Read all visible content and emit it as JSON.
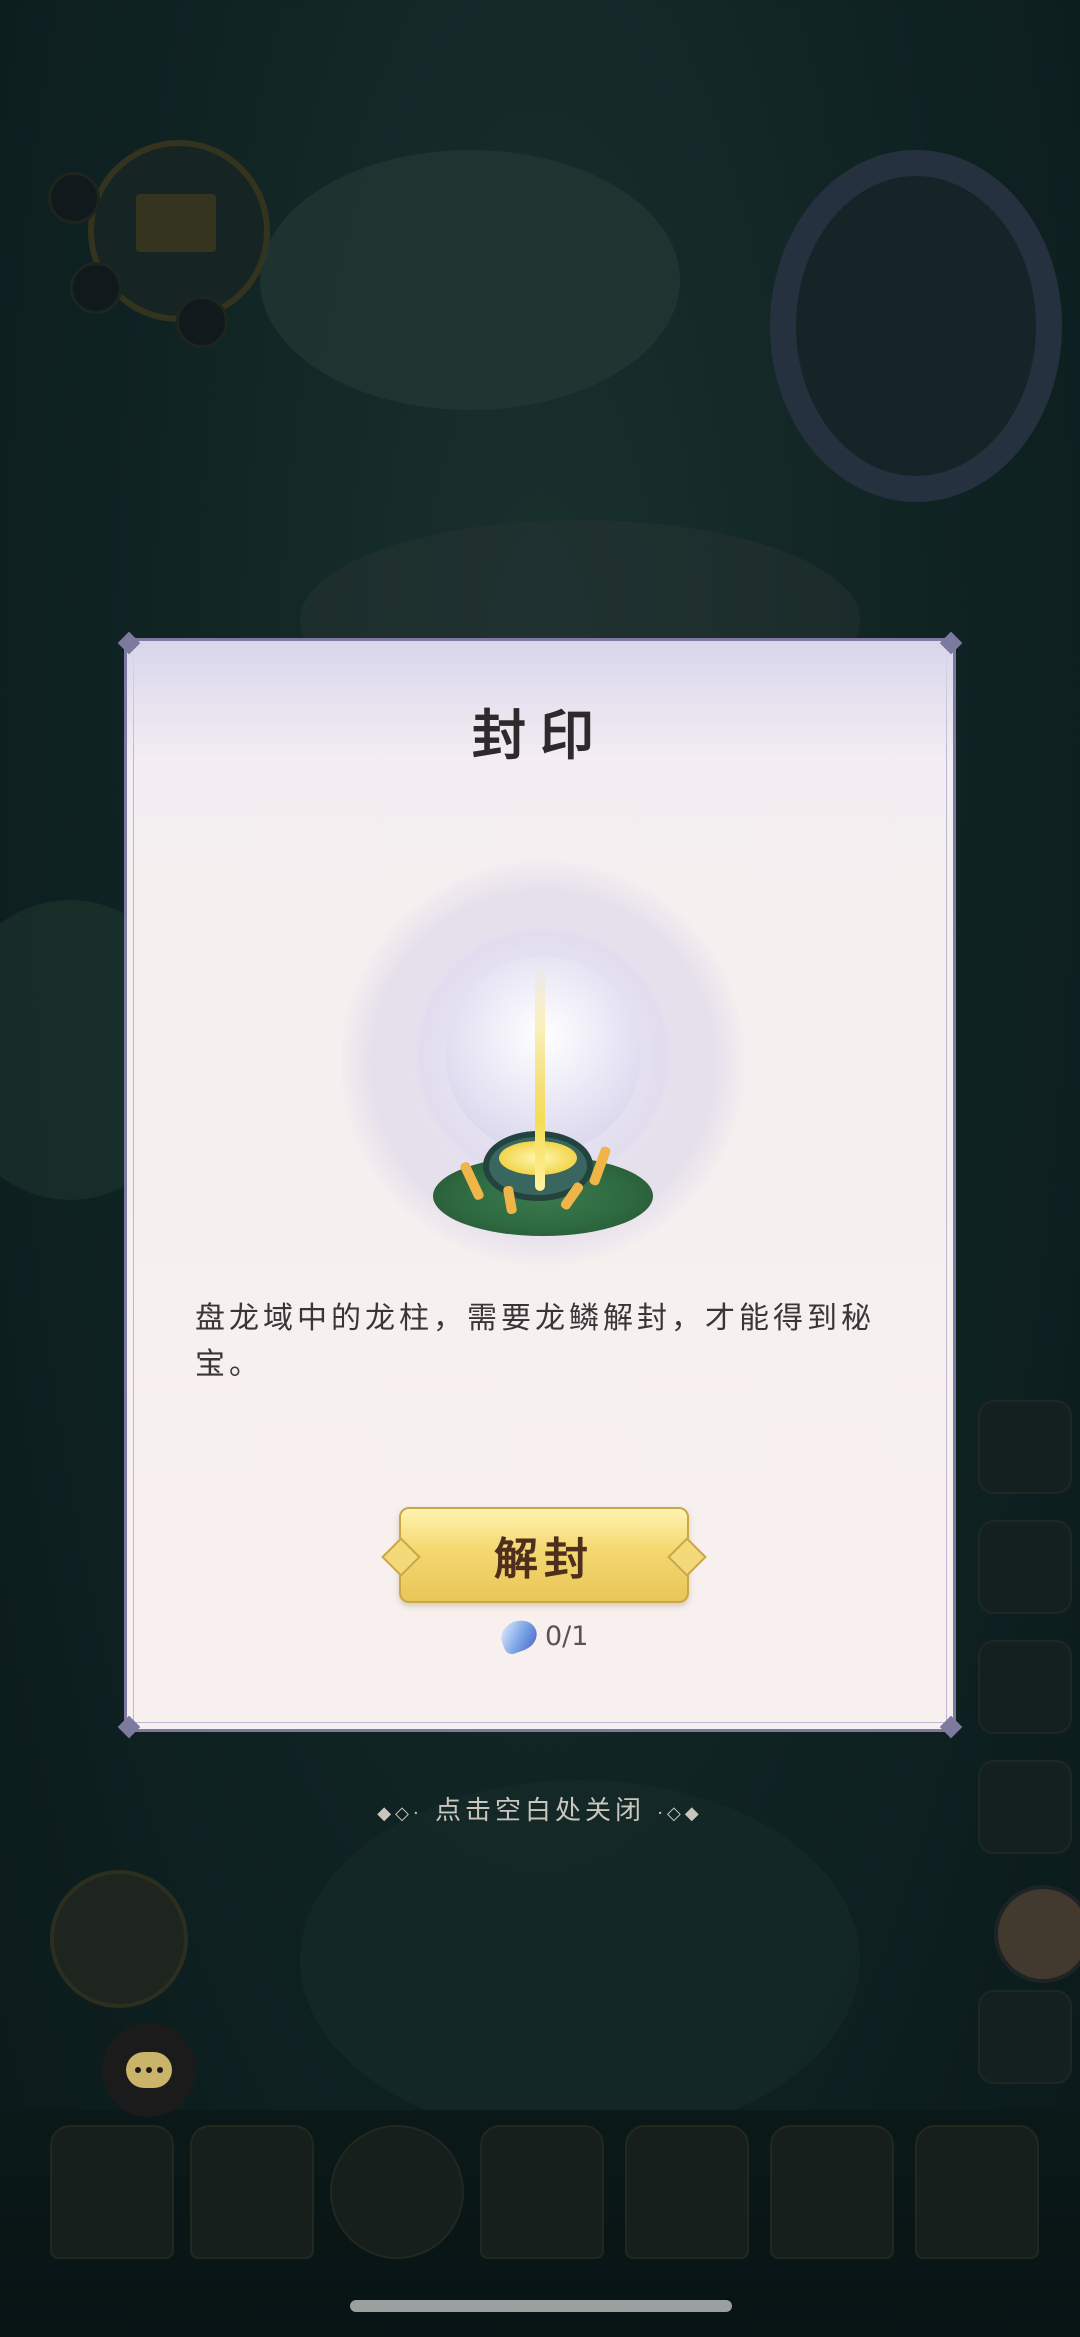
{
  "dialog": {
    "title": "封印",
    "description": "盘龙域中的龙柱，需要龙鳞解封，才能得到秘宝。",
    "unseal_button": "解封",
    "cost_icon": "dragon-scale-icon",
    "cost": "0/1"
  },
  "close_hint": "点击空白处关闭",
  "colors": {
    "dialog_border": "#7d7aa0",
    "button_gold": "#f4d870",
    "button_text": "#4e2f1e"
  }
}
